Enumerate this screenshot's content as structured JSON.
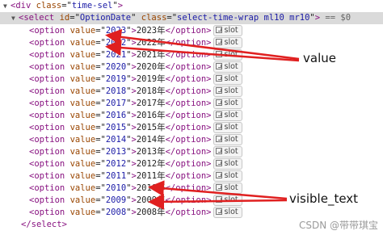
{
  "devtools": {
    "div_open": {
      "tag": "div",
      "attr": "class",
      "value": "time-sel"
    },
    "select_open": {
      "tag": "select",
      "id_attr": "id",
      "id_value": "OptionDate",
      "class_attr": "class",
      "class_value": "select-time-wrap ml10 mr10",
      "selected_marker": "== $0"
    },
    "options": [
      {
        "value": "2023",
        "text": "2023年"
      },
      {
        "value": "2022",
        "text": "2022年"
      },
      {
        "value": "2021",
        "text": "2021年"
      },
      {
        "value": "2020",
        "text": "2020年"
      },
      {
        "value": "2019",
        "text": "2019年"
      },
      {
        "value": "2018",
        "text": "2018年"
      },
      {
        "value": "2017",
        "text": "2017年"
      },
      {
        "value": "2016",
        "text": "2016年"
      },
      {
        "value": "2015",
        "text": "2015年"
      },
      {
        "value": "2014",
        "text": "2014年"
      },
      {
        "value": "2013",
        "text": "2013年"
      },
      {
        "value": "2012",
        "text": "2012年"
      },
      {
        "value": "2011",
        "text": "2011年"
      },
      {
        "value": "2010",
        "text": "2010年"
      },
      {
        "value": "2009",
        "text": "2009年"
      },
      {
        "value": "2008",
        "text": "2008年"
      }
    ],
    "slot_label": "slot",
    "select_close": "</select>"
  },
  "annotations": {
    "value_label": "value",
    "visible_text_label": "visible_text"
  },
  "watermark": "CSDN @带带琪宝",
  "colors": {
    "tag": "#881280",
    "attribute": "#994500",
    "attribute_value": "#1a1aa6",
    "arrow": "#e02020",
    "selected_row_bg": "#dadada"
  }
}
